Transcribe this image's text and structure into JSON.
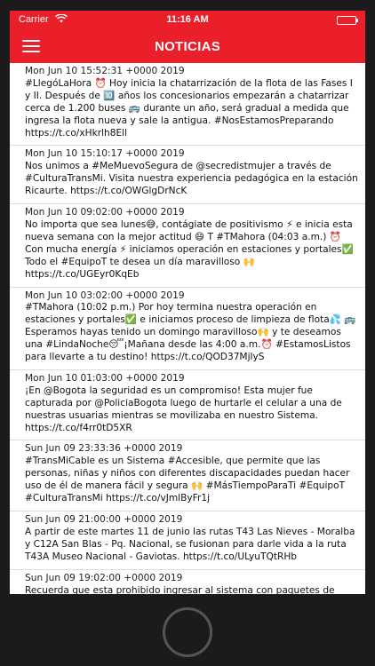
{
  "status_bar": {
    "carrier": "Carrier",
    "wifi_icon": "wifi-icon",
    "time": "11:16 AM",
    "battery_icon": "battery-icon"
  },
  "nav": {
    "menu_icon": "hamburger-menu-icon",
    "title": "NOTICIAS"
  },
  "colors": {
    "brand_red": "#ea1f2a",
    "divider": "#dcdcdc"
  },
  "tweets": [
    {
      "date": "Mon Jun 10 15:52:31 +0000 2019",
      "text": "#LlegóLaHora ⏰ Hoy inicia la chatarrización de la flota de las Fases I y II. Después de 🔟 años los concesionarios empezarán a chatarrizar cerca de 1.200 buses 🚌 durante un año, será gradual a medida que ingresa la flota nueva y sale la antigua. #NosEstamosPreparando https://t.co/xHkrlh8Ell"
    },
    {
      "date": "Mon Jun 10 15:10:17 +0000 2019",
      "text": "Nos unimos a #MeMuevoSegura de @secredistmujer a través de #CulturaTransMi. Visita nuestra experiencia pedagógica en la estación Ricaurte. https://t.co/OWGlgDrNcK"
    },
    {
      "date": "Mon Jun 10 09:02:00 +0000 2019",
      "text": "No importa que sea lunes😅, contágiate de positivismo ⚡ e inicia esta nueva semana con la mejor actitud 😄 T #TMahora (04:03 a.m.) ⏰ Con mucha energía ⚡ iniciamos operación en estaciones y portales✅ Todo el #EquipoT te desea un día maravilloso 🙌 https://t.co/UGEyr0KqEb"
    },
    {
      "date": "Mon Jun 10 03:02:00 +0000 2019",
      "text": "#TMahora (10:02 p.m.) Por hoy termina nuestra operación en estaciones y portales✅ e iniciamos proceso de limpieza de flota💦 🚌 Esperamos hayas tenido un domingo maravilloso🙌 y te deseamos una #LindaNoche😴¡Mañana desde las 4:00 a.m.⏰ #EstamosListos para llevarte a tu destino! https://t.co/QOD37MjlyS"
    },
    {
      "date": "Mon Jun 10 01:03:00 +0000 2019",
      "text": "¡En @Bogota la seguridad es un compromiso! Esta mujer fue capturada por @PoliciaBogota luego de hurtarle el celular a una de nuestras usuarias mientras se movilizaba en nuestro Sistema. https://t.co/f4rr0tD5XR"
    },
    {
      "date": "Sun Jun 09 23:33:36 +0000 2019",
      "text": "#TransMiCable es un Sistema #Accesible, que permite que las personas, niñas y niños con diferentes discapacidades puedan hacer uso de él de manera fácil y segura 🙌 #MásTiempoParaTi #EquipoT #CulturaTransMi https://t.co/vJmlByFr1j"
    },
    {
      "date": "Sun Jun 09 21:00:00 +0000 2019",
      "text": "A partir de este martes 11 de junio las rutas T43 Las Nieves - Moralba y C12A San Blas - Pq. Nacional, se fusionan para darle vida a la ruta T43A Museo Nacional - Gaviotas. https://t.co/ULyuTQtRHb"
    },
    {
      "date": "Sun Jun 09 19:02:00 +0000 2019",
      "text": "Recuerda que esta prohibido ingresar al sistema con paquetes de gran tamaño. Esto hace que el resto de usuarios no puedan usar el"
    }
  ],
  "device": {
    "home_button_icon": "home-button-icon"
  }
}
